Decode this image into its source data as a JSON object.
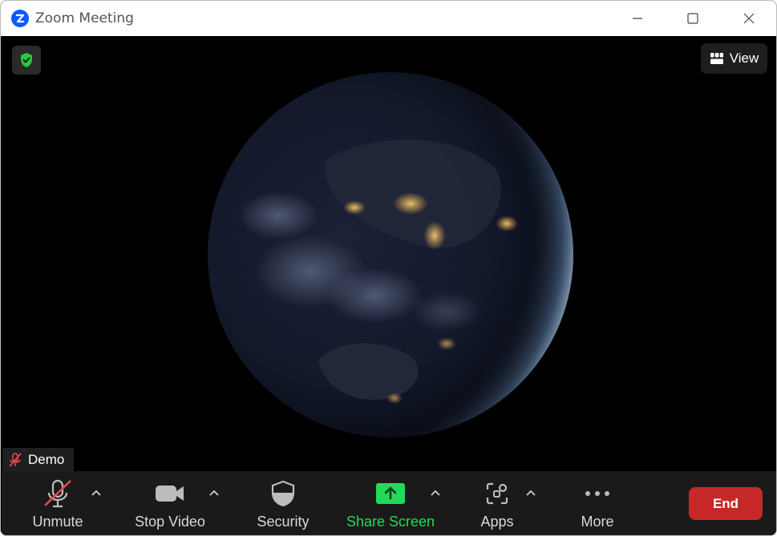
{
  "window": {
    "title": "Zoom Meeting",
    "brand_color": "#0b5cff"
  },
  "stage": {
    "view_label": "View",
    "participant_name": "Demo",
    "encryption_color": "#27c93f"
  },
  "toolbar": {
    "unmute_label": "Unmute",
    "stop_video_label": "Stop Video",
    "security_label": "Security",
    "share_screen_label": "Share Screen",
    "apps_label": "Apps",
    "more_label": "More",
    "end_label": "End",
    "share_color": "#23d959",
    "end_color": "#c62828"
  }
}
